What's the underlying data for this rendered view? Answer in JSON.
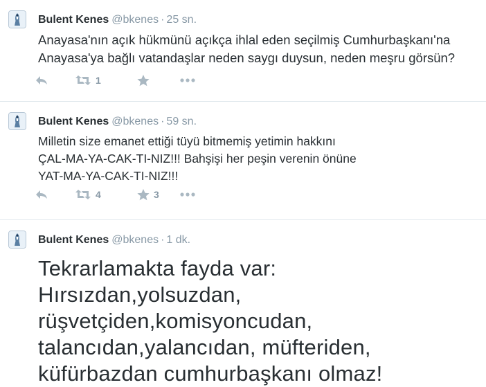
{
  "tweets": [
    {
      "name": "Bulent Kenes",
      "handle": "@bkenes",
      "dot": "·",
      "time": "25 sn.",
      "lines": [
        "Anayasa'nın açık hükmünü açıkça ihlal eden seçilmiş Cumhurbaşkanı'na",
        "Anayasa'ya bağlı vatandaşlar neden saygı duysun, neden meşru görsün?"
      ],
      "retweets": "1",
      "favorites": ""
    },
    {
      "name": "Bulent Kenes",
      "handle": "@bkenes",
      "dot": "·",
      "time": "59 sn.",
      "lines": [
        "Milletin size emanet ettiği tüyü bitmemiş yetimin hakkını",
        "ÇAL-MA-YA-CAK-TI-NIZ!!! Bahşişi her peşin verenin önüne",
        "YAT-MA-YA-CAK-TI-NIZ!!!"
      ],
      "retweets": "4",
      "favorites": "3"
    },
    {
      "name": "Bulent Kenes",
      "handle": "@bkenes",
      "dot": "·",
      "time": "1 dk.",
      "lines": [
        "Tekrarlamakta fayda var:",
        "Hırsızdan,yolsuzdan,",
        "rüşvetçiden,komisyoncudan,",
        "talancıdan,yalancıdan, müfteriden,",
        "küfürbazdan cumhurbaşkanı olmaz!"
      ]
    }
  ],
  "icons": {
    "reply": "reply-arrow",
    "retweet": "retweet-arrows",
    "favorite": "star",
    "more": "ellipsis"
  },
  "colors": {
    "text": "#292f33",
    "muted": "#8899a6",
    "icon": "#aab8c2",
    "divider": "#e1e8ed"
  }
}
